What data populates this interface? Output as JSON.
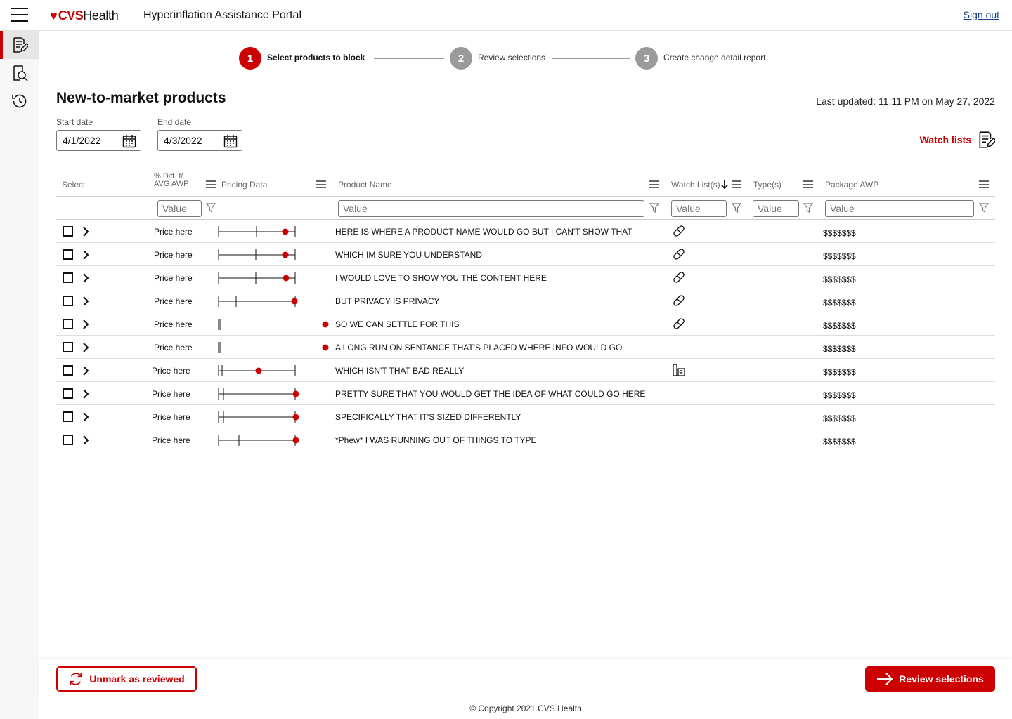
{
  "header": {
    "brand_cvs": "CVS",
    "brand_health": "Health",
    "app_title": "Hyperinflation Assistance Portal",
    "signout_label": "Sign out"
  },
  "rail": {
    "items": [
      "edit-list-icon",
      "search-document-icon",
      "history-icon"
    ]
  },
  "stepper": {
    "steps": [
      {
        "number": "1",
        "label": "Select products to block",
        "active": true
      },
      {
        "number": "2",
        "label": "Review selections",
        "active": false
      },
      {
        "number": "3",
        "label": "Create change detail report",
        "active": false
      }
    ]
  },
  "page": {
    "title": "New-to-market products",
    "last_updated": "Last updated: 11:11 PM on May 27, 2022",
    "start_date_label": "Start date",
    "start_date_value": "4/1/2022",
    "end_date_label": "End date",
    "end_date_value": "4/3/2022",
    "watch_lists_label": "Watch lists"
  },
  "table": {
    "columns": {
      "select": "Select",
      "diff_line1": "% Diff. f/",
      "diff_line2": "AVG  AWP",
      "pricing": "Pricing Data",
      "product_name": "Product Name",
      "watch_lists": "Watch List(s)",
      "types": "Type(s)",
      "package_awp": "Package AWP"
    },
    "filter_placeholder": "Value",
    "rows": [
      {
        "price": "Price here",
        "name": "HERE IS WHERE A PRODUCT NAME WOULD GO BUT  I CAN'T SHOW THAT",
        "watch": "pill",
        "awp": "$$$$$$$"
      },
      {
        "price": "Price here",
        "name": "WHICH IM SURE YOU UNDERSTAND",
        "watch": "pill",
        "awp": "$$$$$$$"
      },
      {
        "price": "Price here",
        "name": "I WOULD LOVE TO SHOW YOU THE CONTENT HERE",
        "watch": "pill",
        "awp": "$$$$$$$"
      },
      {
        "price": "Price here",
        "name": "BUT PRIVACY IS PRIVACY",
        "watch": "pill",
        "awp": "$$$$$$$"
      },
      {
        "price": "Price here",
        "name": "SO WE CAN SETTLE FOR THIS",
        "watch": "pill",
        "awp": "$$$$$$$"
      },
      {
        "price": "Price here",
        "name": "A LONG RUN ON SENTANCE THAT'S PLACED WHERE INFO WOULD GO",
        "watch": "",
        "awp": "$$$$$$$"
      },
      {
        "price": "Price here",
        "name": "WHICH ISN'T THAT BAD REALLY",
        "watch": "building",
        "awp": "$$$$$$$"
      },
      {
        "price": "Price here",
        "name": "PRETTY SURE THAT YOU WOULD GET THE IDEA OF WHAT COULD GO HERE",
        "watch": "",
        "awp": "$$$$$$$"
      },
      {
        "price": "Price here",
        "name": "SPECIFICALLY THAT IT'S SIZED DIFFERENTLY",
        "watch": "",
        "awp": "$$$$$$$"
      },
      {
        "price": "Price here",
        "name": "*Phew* I WAS RUNNING OUT OF THINGS TO TYPE",
        "watch": "",
        "awp": "$$$$$$$"
      }
    ]
  },
  "footer": {
    "unmark_label": "Unmark as reviewed",
    "review_label": "Review selections",
    "copyright": "© Copyright 2021 CVS Health"
  },
  "colors": {
    "accent": "#cc0000",
    "step_inactive": "#9a9a9a",
    "link": "#1a3f8f"
  }
}
